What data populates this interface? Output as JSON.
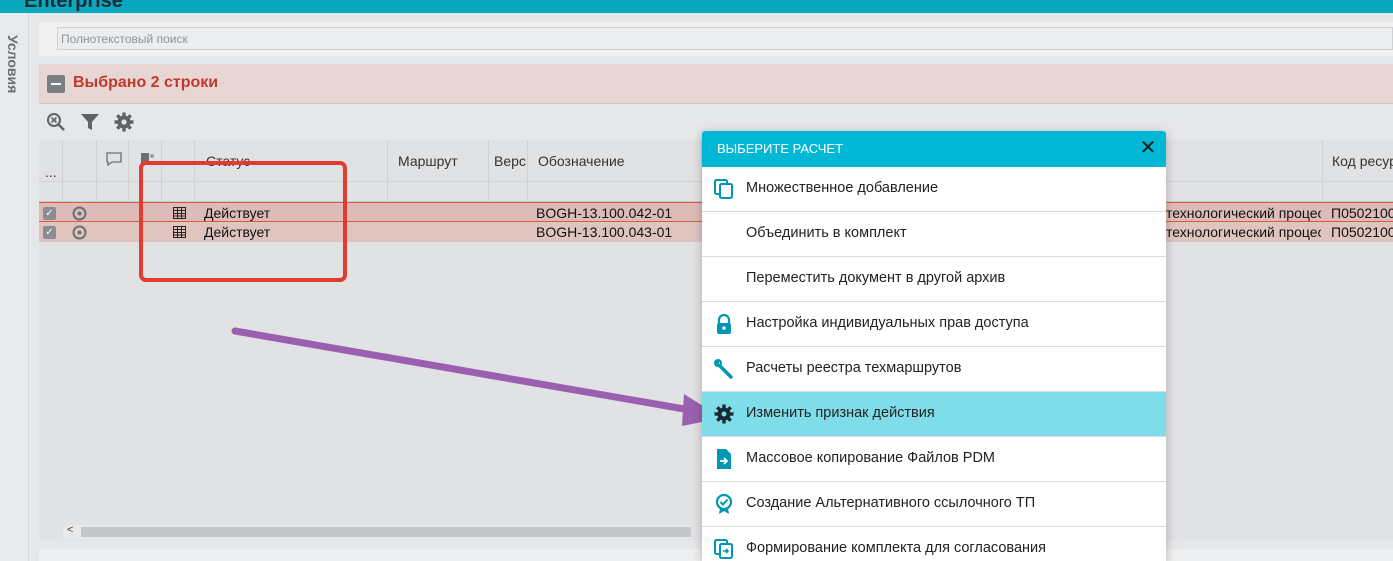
{
  "app": {
    "brand": "Enterprise"
  },
  "side": {
    "conditions_label": "Условия"
  },
  "search": {
    "placeholder": "Полнотекстовый поиск"
  },
  "panel": {
    "title": "Выбрано 2 строки"
  },
  "toolbar": {
    "icons": [
      "search-clear-icon",
      "filter-icon",
      "settings-icon"
    ]
  },
  "table": {
    "columns": [
      "...",
      "Статус",
      "Маршрут",
      "Верс",
      "Обозначение",
      "Код ресур"
    ],
    "rows": [
      {
        "status": "Действует",
        "designation": "BOGH-13.100.042-01",
        "type": "технологический процес",
        "code": "П0502100"
      },
      {
        "status": "Действует",
        "designation": "BOGH-13.100.043-01",
        "type": "технологический процес",
        "code": "П0502100"
      }
    ]
  },
  "popup": {
    "title": "ВЫБЕРИТЕ РАСЧЕТ",
    "close": "✕",
    "items": [
      {
        "label": "Множественное добавление",
        "icon": "copy-icon"
      },
      {
        "label": "Объединить в комплект",
        "icon": ""
      },
      {
        "label": "Переместить документ в другой архив",
        "icon": ""
      },
      {
        "label": "Настройка индивидуальных прав доступа",
        "icon": "lock-icon"
      },
      {
        "label": "Расчеты реестра техмаршрутов",
        "icon": "wrench-icon"
      },
      {
        "label": "Изменить признак действия",
        "icon": "gear-icon"
      },
      {
        "label": "Массовое копирование Файлов PDM",
        "icon": "file-export-icon"
      },
      {
        "label": "Создание Альтернативного ссылочного ТП",
        "icon": "badge-check-icon"
      },
      {
        "label": "Формирование комплекта для согласования",
        "icon": "copy-arrow-icon"
      }
    ]
  },
  "colors": {
    "accent": "#00b8d6",
    "highlight": "#7edde9",
    "title_red": "#c0392b",
    "annotation_red": "#e23b32",
    "arrow": "#9b5fb0"
  }
}
